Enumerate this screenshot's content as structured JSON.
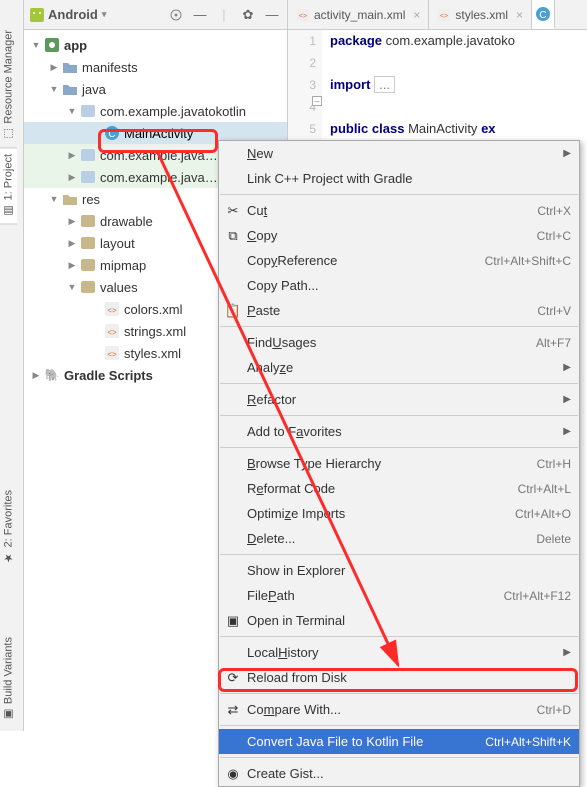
{
  "sidebarTabs": {
    "resource": "Resource Manager",
    "project": "1: Project",
    "favorites": "2: Favorites",
    "build": "Build Variants"
  },
  "treeToolbar": {
    "label": "Android"
  },
  "tree": {
    "app": "app",
    "manifests": "manifests",
    "java": "java",
    "pkg1": "com.example.javatokotlin",
    "mainActivity": "MainActivity",
    "pkg2": "com.example.java…",
    "pkg3": "com.example.java…",
    "res": "res",
    "drawable": "drawable",
    "layout": "layout",
    "mipmap": "mipmap",
    "values": "values",
    "colors": "colors.xml",
    "strings": "strings.xml",
    "styles": "styles.xml",
    "gradle": "Gradle Scripts"
  },
  "editorTabs": {
    "activity": "activity_main.xml",
    "styles": "styles.xml"
  },
  "gutter": [
    "1",
    "2",
    "3",
    "4",
    "5"
  ],
  "code": {
    "package": "package",
    "pkgName": "com.example.javatoko",
    "import": "import",
    "dots": "...",
    "public": "public",
    "class": "class",
    "mainClass": "MainActivity",
    "ex": "ex"
  },
  "menu": {
    "new": "New",
    "linkCpp": "Link C++ Project with Gradle",
    "cut": "Cut",
    "copy": "Copy",
    "copyRef": "Copy Reference",
    "copyPath": "Copy Path...",
    "paste": "Paste",
    "findUsages": "Find Usages",
    "analyze": "Analyze",
    "refactor": "Refactor",
    "addFav": "Add to Favorites",
    "browseHier": "Browse Type Hierarchy",
    "reformat": "Reformat Code",
    "optimize": "Optimize Imports",
    "delete": "Delete...",
    "showExplorer": "Show in Explorer",
    "filePath": "File Path",
    "openTerminal": "Open in Terminal",
    "localHist": "Local History",
    "reload": "Reload from Disk",
    "compare": "Compare With...",
    "convert": "Convert Java File to Kotlin File",
    "createGist": "Create Gist...",
    "sc": {
      "cut": "Ctrl+X",
      "copy": "Ctrl+C",
      "copyRef": "Ctrl+Alt+Shift+C",
      "paste": "Ctrl+V",
      "findUsages": "Alt+F7",
      "browseHier": "Ctrl+H",
      "reformat": "Ctrl+Alt+L",
      "optimize": "Ctrl+Alt+O",
      "delete": "Delete",
      "filePath": "Ctrl+Alt+F12",
      "compare": "Ctrl+D",
      "convert": "Ctrl+Alt+Shift+K"
    }
  }
}
